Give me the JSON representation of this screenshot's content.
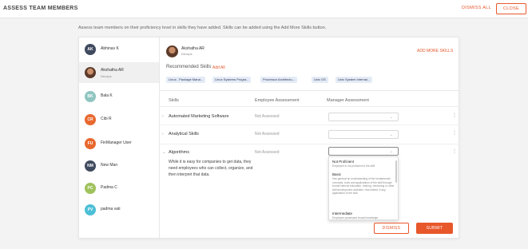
{
  "header": {
    "title": "ASSESS TEAM MEMBERS",
    "dismiss_all": "DISMISS ALL",
    "close": "CLOSE"
  },
  "description": "Assess team members on their proficiency level in skills they have added. Skills can be added using the Add More Skills button.",
  "members": [
    {
      "initials": "AK",
      "name": "Abhinav K",
      "sub": "",
      "color": "#3f4a5e",
      "photo": false
    },
    {
      "initials": "",
      "name": "Akshatha AR",
      "sub": "Devops",
      "color": "",
      "photo": true
    },
    {
      "initials": "BK",
      "name": "Bala K",
      "sub": "",
      "color": "#8fc5c0",
      "photo": false
    },
    {
      "initials": "CR",
      "name": "Cibi R",
      "sub": "",
      "color": "#e8682e",
      "photo": false
    },
    {
      "initials": "FU",
      "name": "FinManager User",
      "sub": "",
      "color": "#e8682e",
      "photo": false
    },
    {
      "initials": "NM",
      "name": "New Man",
      "sub": "",
      "color": "#3f4a5e",
      "photo": false
    },
    {
      "initials": "PC",
      "name": "Padma C",
      "sub": "",
      "color": "#9fc25a",
      "photo": false
    },
    {
      "initials": "PV",
      "name": "padma vati",
      "sub": "",
      "color": "#4dbfd6",
      "photo": false
    }
  ],
  "selected": {
    "name": "Akshatha AR",
    "sub": "Devops"
  },
  "add_more_skills": "ADD MORE SKILLS",
  "recommended": {
    "label": "Recommended Skills",
    "add_all": "Add All"
  },
  "chips": [
    "Linux - Package Mana...",
    "Linux Systems Progra...",
    "Processor Architectu...",
    "Unix OS",
    "Unix System Internal..."
  ],
  "table": {
    "col_skills": "Skills",
    "col_employee": "Employee Assessment",
    "col_manager": "Manager Assessment"
  },
  "skills": [
    {
      "name": "Automated Marketing Software",
      "employee": "Not Assessed"
    },
    {
      "name": "Analytical Skills",
      "employee": "Not Assessed"
    },
    {
      "name": "Algorithms",
      "employee": "Not Assessed",
      "description": "While it is easy for companies to get data, they need employees who can collect, organize, and then interpret that data."
    }
  ],
  "dropdown_options": [
    {
      "title": "Not Proficient",
      "desc": "Employee is not proficient in the skill"
    },
    {
      "title": "Basic",
      "desc": "Has general an understanding of the fundamental concepts, tools and applications of the skill through formal internal education, training, mentoring or other skill development activities. Has limited, if any, application of the skill."
    },
    {
      "title": "Intermediate",
      "desc": "Employee possesses broad knowledge"
    }
  ],
  "buttons": {
    "dismiss": "DISMISS",
    "submit": "SUBMIT"
  },
  "colors": {
    "accent": "#e8572a",
    "chip_bg": "#e3ecf6"
  }
}
